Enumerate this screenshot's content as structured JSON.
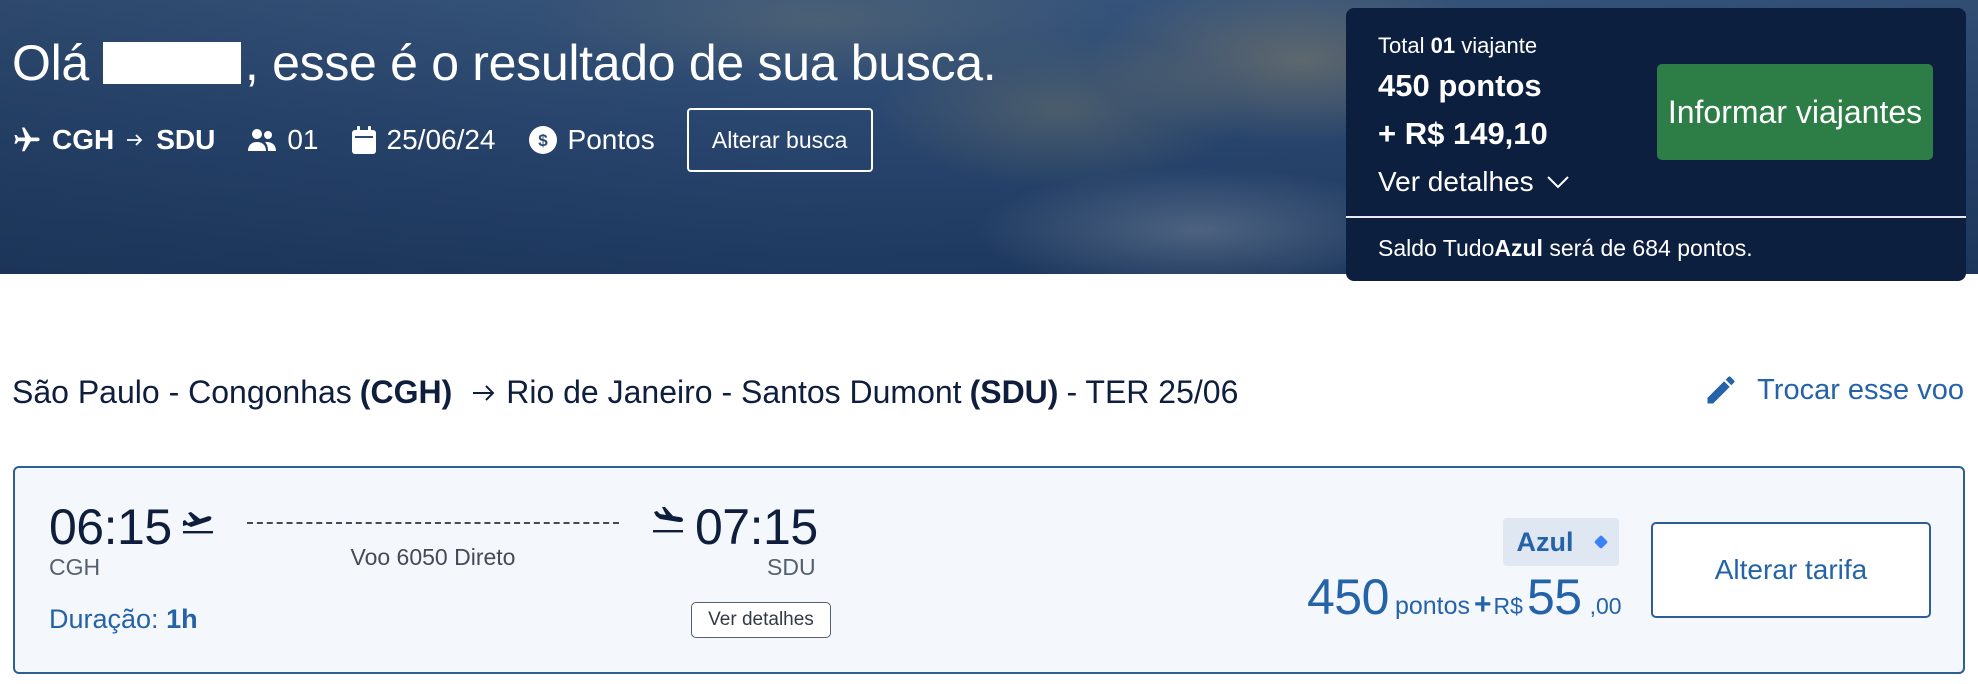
{
  "hero": {
    "greeting_prefix": "Olá",
    "greeting_suffix": ", esse é o resultado de sua busca.",
    "origin": "CGH",
    "destination": "SDU",
    "passengers": "01",
    "date": "25/06/24",
    "payment_mode": "Pontos",
    "change_search_label": "Alterar busca"
  },
  "summary": {
    "total_prefix": "Total",
    "traveler_count": "01",
    "total_suffix": "viajante",
    "points_total": "450 pontos",
    "money_total": "+ R$ 149,10",
    "details_label": "Ver detalhes",
    "cta_label": "Informar viajantes",
    "balance_prefix": "Saldo Tudo",
    "balance_brand": "Azul",
    "balance_suffix": "será de 684 pontos."
  },
  "route": {
    "origin_name": "São Paulo - Congonhas",
    "origin_code": "(CGH)",
    "dest_name": "Rio de Janeiro - Santos Dumont",
    "dest_code": "(SDU)",
    "date_label": "- TER 25/06",
    "change_label": "Trocar esse voo"
  },
  "flight": {
    "departure_time": "06:15",
    "departure_code": "CGH",
    "arrival_time": "07:15",
    "arrival_code": "SDU",
    "flight_label": "Voo 6050 Direto",
    "duration_label": "Duração:",
    "duration_value": "1h",
    "details_label": "Ver detalhes",
    "fare_name": "Azul",
    "price_points": "450",
    "price_points_unit": "pontos",
    "price_plus": "+",
    "price_currency": "R$",
    "price_money": "55",
    "price_cents": ",00",
    "change_fare_label": "Alterar tarifa"
  },
  "colors": {
    "navy": "#0d1f3f",
    "accent_blue": "#2563a8",
    "cta_green": "#2d7d46",
    "card_border": "#2e5f93"
  },
  "icons": [
    "airplane-icon",
    "arrow-right-icon",
    "people-icon",
    "calendar-icon",
    "dollar-coin-icon",
    "chevron-down-icon",
    "pencil-icon",
    "takeoff-icon",
    "landing-icon",
    "diamond-icon"
  ]
}
